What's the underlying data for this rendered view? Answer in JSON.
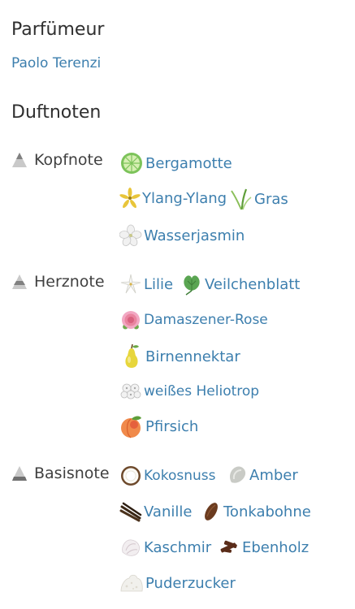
{
  "perfumer": {
    "heading": "Parfümeur",
    "name": "Paolo Terenzi"
  },
  "notes": {
    "heading": "Duftnoten",
    "top": {
      "label": "Kopfnote",
      "items": [
        "Bergamotte",
        "Ylang-Ylang",
        "Gras",
        "Wasserjasmin"
      ]
    },
    "heart": {
      "label": "Herznote",
      "items": [
        "Lilie",
        "Veilchenblatt",
        "Damaszener-Rose",
        "Birnennektar",
        "weißes Heliotrop",
        "Pfirsich"
      ]
    },
    "base": {
      "label": "Basisnote",
      "items": [
        "Kokosnuss",
        "Amber",
        "Vanille",
        "Tonkabohne",
        "Kaschmir",
        "Ebenholz",
        "Puderzucker"
      ]
    }
  },
  "icons": {
    "tier": "pyramid-icon",
    "top": [
      "bergamot-icon",
      "ylang-ylang-icon",
      "grass-icon",
      "water-jasmine-icon"
    ],
    "heart": [
      "lily-icon",
      "violet-leaf-icon",
      "rose-icon",
      "pear-icon",
      "heliotrope-icon",
      "peach-icon"
    ],
    "base": [
      "coconut-icon",
      "amber-icon",
      "vanilla-icon",
      "tonka-bean-icon",
      "cashmere-icon",
      "ebony-icon",
      "powdered-sugar-icon"
    ]
  },
  "colors": {
    "link": "#3d7fae",
    "heading": "#2f2f2f",
    "label": "#404040"
  }
}
